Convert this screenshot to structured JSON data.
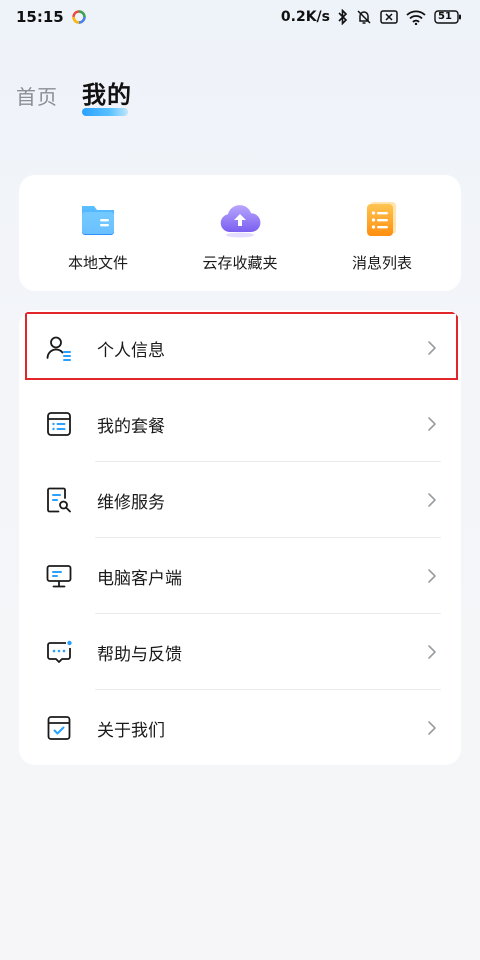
{
  "status_bar": {
    "time": "15:15",
    "net_speed": "0.2K/s",
    "battery": "51"
  },
  "tabs": {
    "home": "首页",
    "mine": "我的"
  },
  "quick": [
    {
      "label": "本地文件",
      "icon": "folder-icon",
      "color": "#3aa6ff"
    },
    {
      "label": "云存收藏夹",
      "icon": "cloud-upload-icon",
      "color": "#8f74f0"
    },
    {
      "label": "消息列表",
      "icon": "message-list-icon",
      "color": "#ffa51e"
    }
  ],
  "menu": [
    {
      "label": "个人信息",
      "icon": "person-info-icon"
    },
    {
      "label": "我的套餐",
      "icon": "plan-list-icon"
    },
    {
      "label": "维修服务",
      "icon": "repair-doc-icon"
    },
    {
      "label": "电脑客户端",
      "icon": "monitor-icon"
    },
    {
      "label": "帮助与反馈",
      "icon": "feedback-icon"
    },
    {
      "label": "关于我们",
      "icon": "about-icon"
    }
  ],
  "colors": {
    "accent": "#2aa0ff",
    "highlight_border": "#e0262b"
  }
}
